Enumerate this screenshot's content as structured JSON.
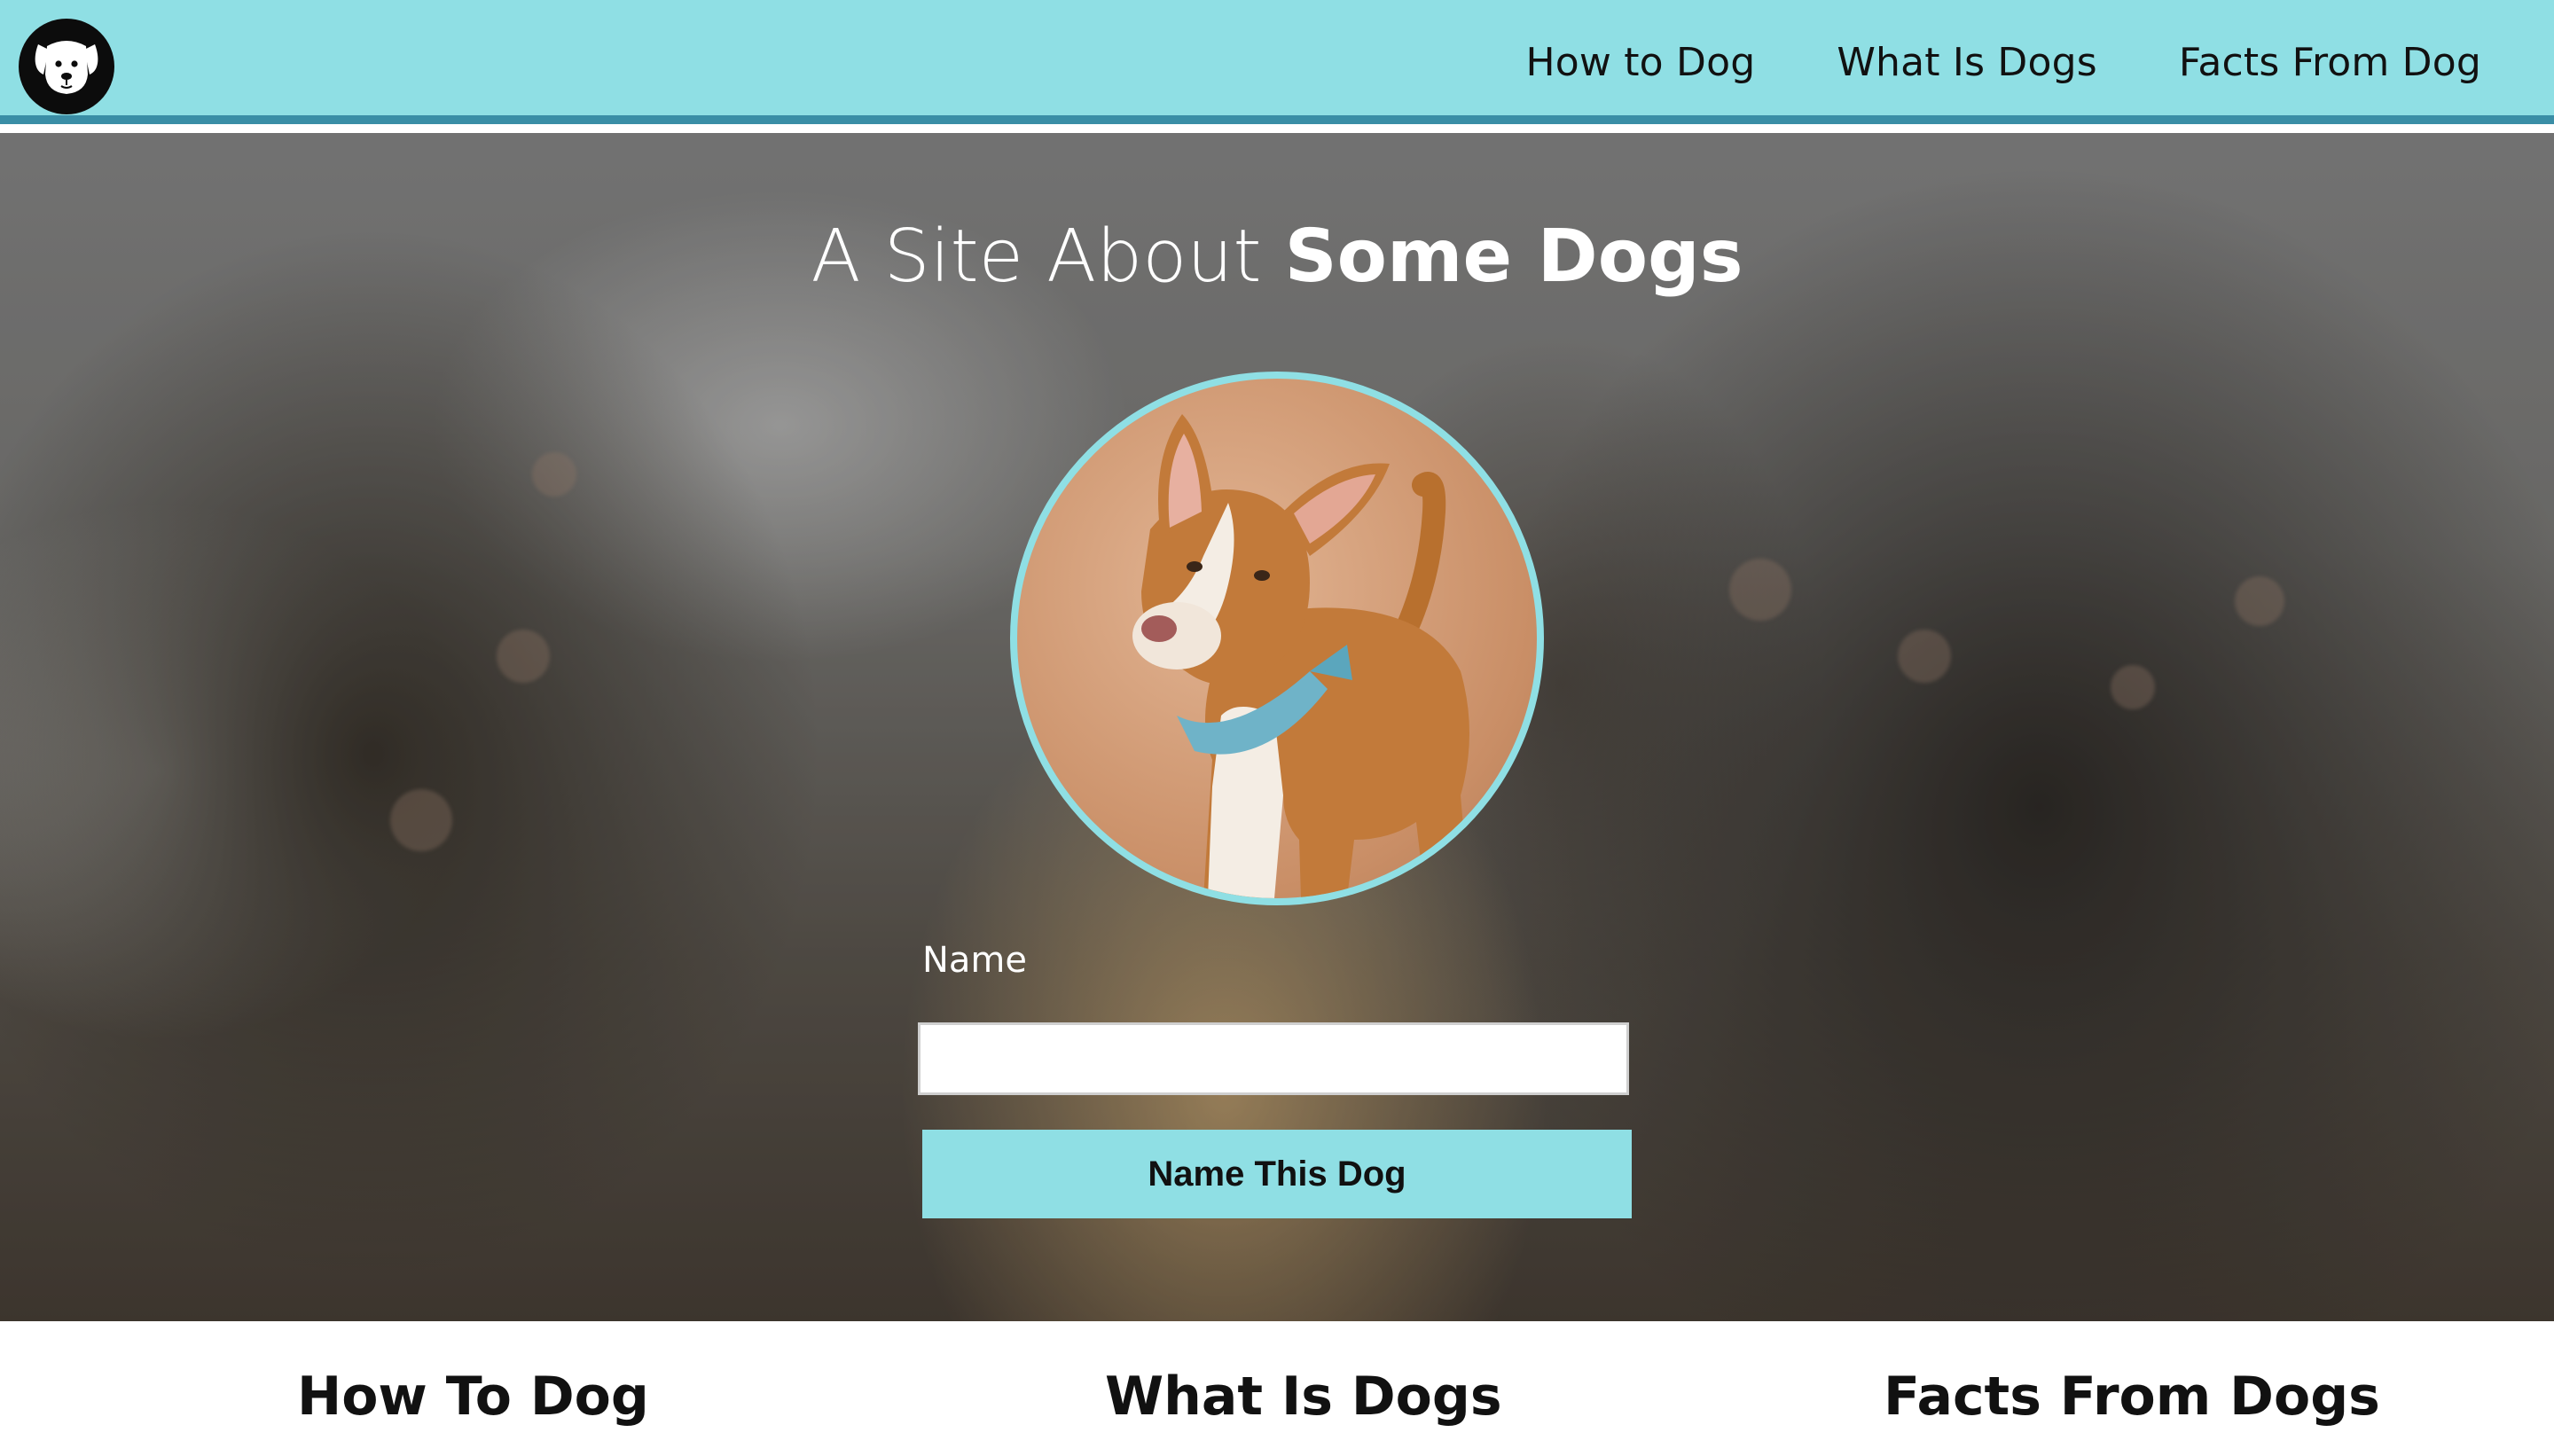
{
  "header": {
    "logo_icon": "dog-face-icon",
    "nav": [
      {
        "label": "How to Dog"
      },
      {
        "label": "What Is Dogs"
      },
      {
        "label": "Facts From Dog"
      }
    ]
  },
  "hero": {
    "title_prefix": "A Site About ",
    "title_bold": "Some Dogs",
    "photo_icon": "dog-photo",
    "form": {
      "name_label": "Name",
      "name_value": "",
      "name_placeholder": "",
      "button_label": "Name This Dog"
    }
  },
  "sections": [
    {
      "title": "How To Dog"
    },
    {
      "title": "What Is Dogs"
    },
    {
      "title": "Facts From Dogs"
    }
  ],
  "colors": {
    "accent": "#8fdfe4",
    "header_border": "#3a8ea6"
  }
}
